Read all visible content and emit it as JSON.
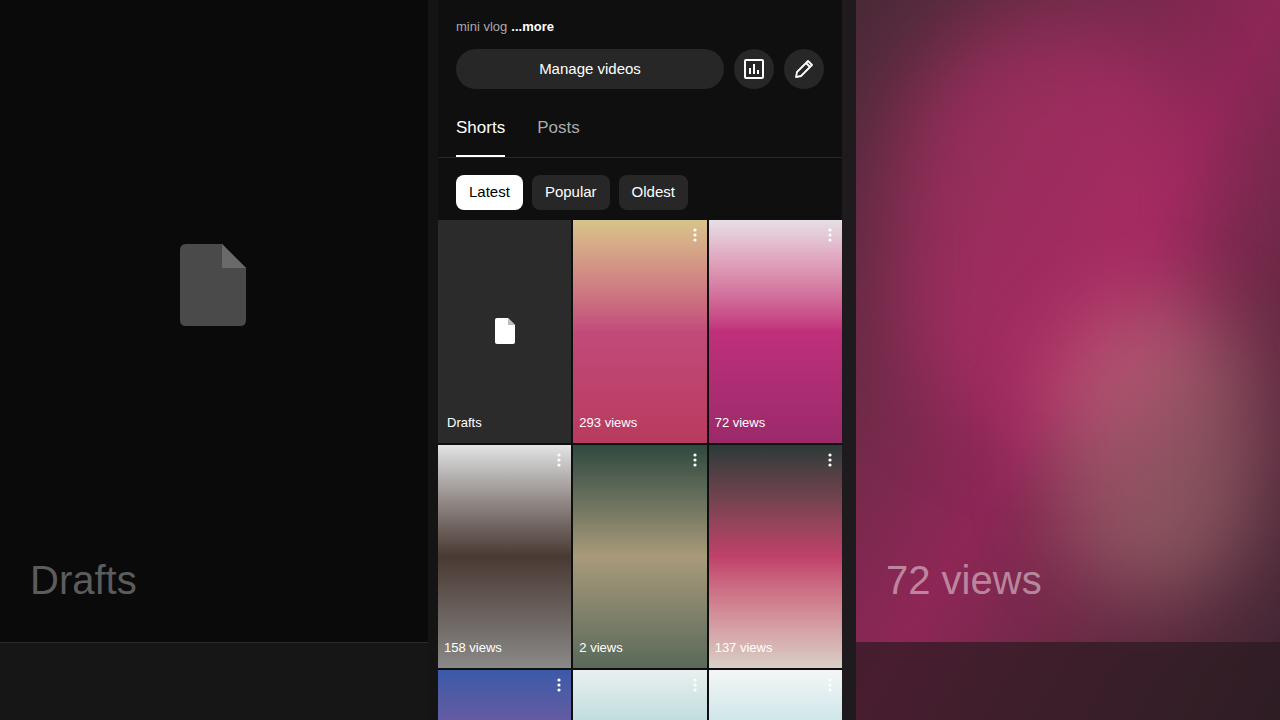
{
  "channel": {
    "description": "mini vlog",
    "more": "...more"
  },
  "buttons": {
    "manage": "Manage videos"
  },
  "tabs": [
    {
      "label": "Shorts",
      "selected": true
    },
    {
      "label": "Posts",
      "selected": false
    }
  ],
  "filters": [
    {
      "label": "Latest",
      "selected": true
    },
    {
      "label": "Popular",
      "selected": false
    },
    {
      "label": "Oldest",
      "selected": false
    }
  ],
  "tiles": [
    {
      "kind": "drafts",
      "label": "Drafts"
    },
    {
      "kind": "short",
      "views": "293 views"
    },
    {
      "kind": "short",
      "views": "72 views"
    },
    {
      "kind": "short",
      "views": "158 views"
    },
    {
      "kind": "short",
      "views": "2 views"
    },
    {
      "kind": "short",
      "views": "137 views"
    },
    {
      "kind": "partial"
    },
    {
      "kind": "partial"
    },
    {
      "kind": "partial"
    }
  ],
  "backdrop": {
    "left_label": "Drafts",
    "right_label": "72 views"
  }
}
